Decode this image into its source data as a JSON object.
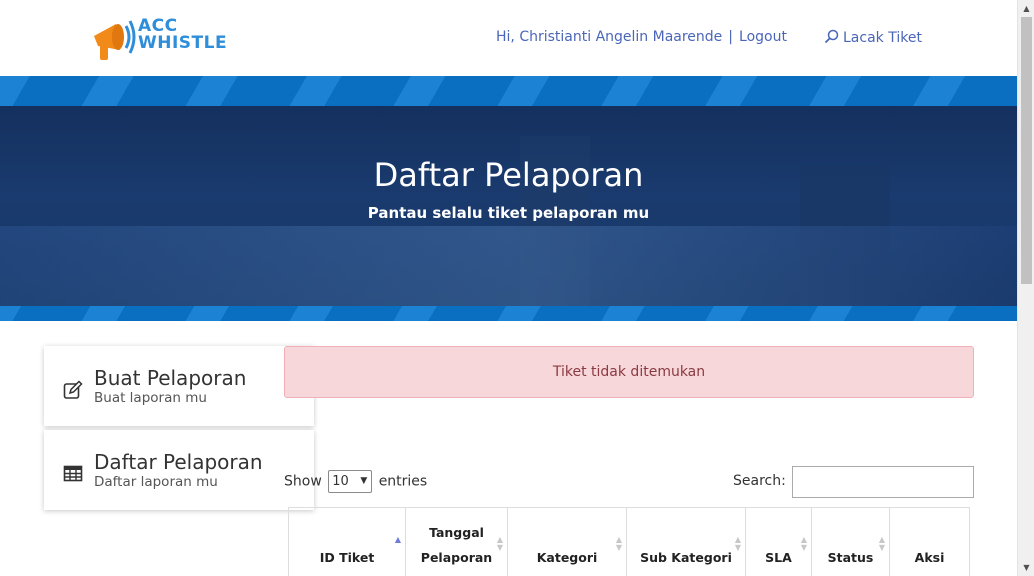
{
  "brand": {
    "logo_line1": "ACC",
    "logo_line2": "WHISTLE"
  },
  "header": {
    "greeting": "Hi, Christianti Angelin Maarende",
    "separator": "|",
    "logout": "Logout",
    "track_ticket": "Lacak Tiket"
  },
  "hero": {
    "title": "Daftar Pelaporan",
    "subtitle": "Pantau selalu tiket pelaporan mu"
  },
  "sidebar": {
    "items": [
      {
        "title": "Buat Pelaporan",
        "subtitle": "Buat laporan mu",
        "icon": "edit-icon"
      },
      {
        "title": "Daftar Pelaporan",
        "subtitle": "Daftar laporan mu",
        "icon": "table-icon"
      }
    ]
  },
  "alert": {
    "message": "Tiket tidak ditemukan",
    "color": "#f8d7da"
  },
  "table_controls": {
    "show_label": "Show",
    "entries_value": "10",
    "entries_label": "entries",
    "search_label": "Search:",
    "search_value": ""
  },
  "table": {
    "columns": [
      {
        "line1": "",
        "line2": "ID Tiket",
        "sort": "asc"
      },
      {
        "line1": "Tanggal",
        "line2": "Pelaporan",
        "sort": "none"
      },
      {
        "line1": "",
        "line2": "Kategori",
        "sort": "none"
      },
      {
        "line1": "",
        "line2": "Sub Kategori",
        "sort": "none"
      },
      {
        "line1": "",
        "line2": "SLA",
        "sort": "none"
      },
      {
        "line1": "",
        "line2": "Status",
        "sort": "none"
      },
      {
        "line1": "",
        "line2": "Aksi",
        "sort": "disabled"
      }
    ]
  },
  "colors": {
    "accent": "#4a66b8",
    "brand_blue": "#0a6fc0",
    "hero_bg": "#14305e"
  }
}
